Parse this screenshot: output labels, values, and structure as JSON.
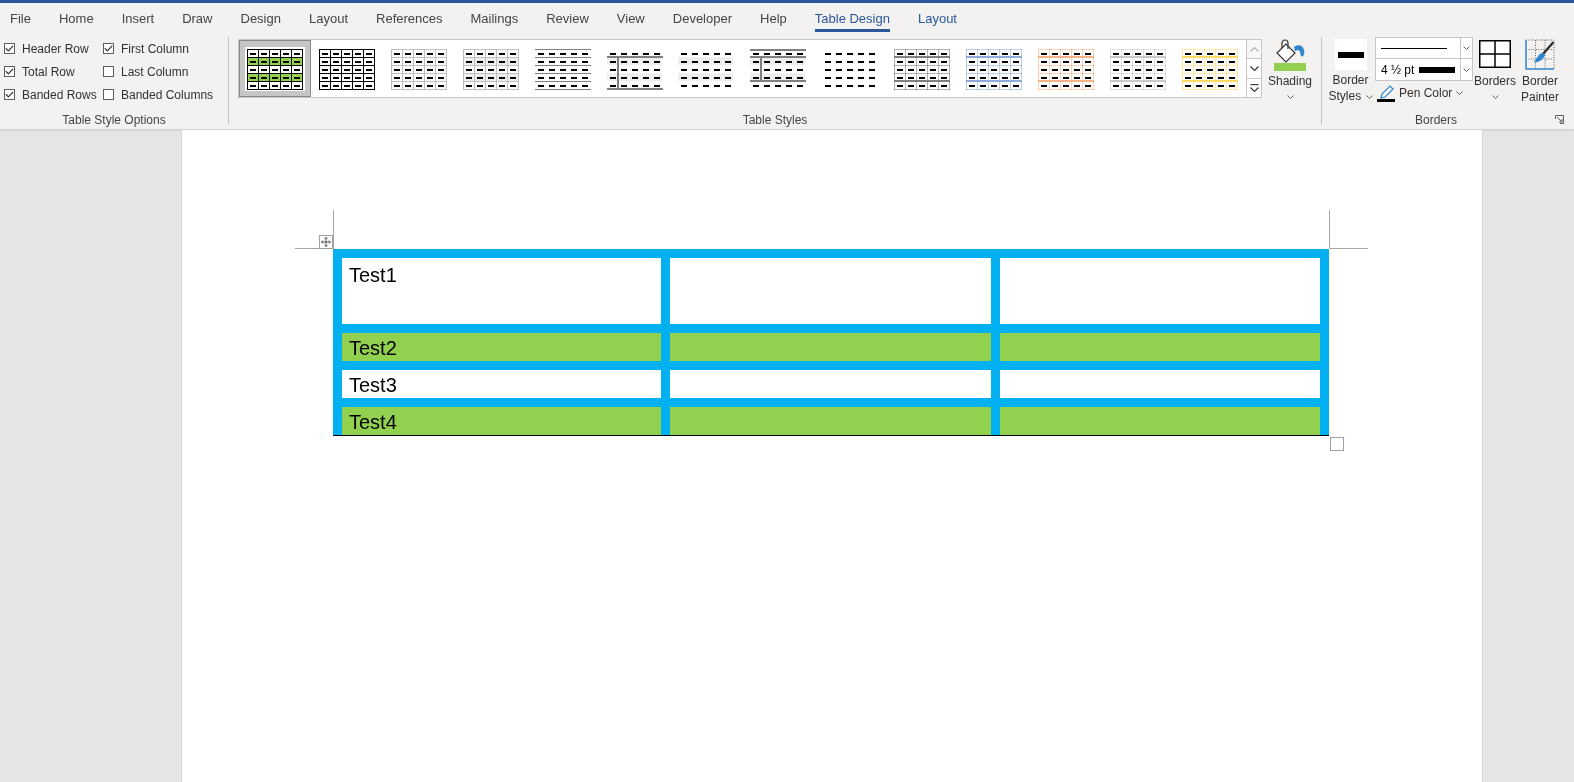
{
  "ribbon_tabs": [
    {
      "label": "File",
      "selected": false,
      "contextual": false
    },
    {
      "label": "Home",
      "selected": false,
      "contextual": false
    },
    {
      "label": "Insert",
      "selected": false,
      "contextual": false
    },
    {
      "label": "Draw",
      "selected": false,
      "contextual": false
    },
    {
      "label": "Design",
      "selected": false,
      "contextual": false
    },
    {
      "label": "Layout",
      "selected": false,
      "contextual": false
    },
    {
      "label": "References",
      "selected": false,
      "contextual": false
    },
    {
      "label": "Mailings",
      "selected": false,
      "contextual": false
    },
    {
      "label": "Review",
      "selected": false,
      "contextual": false
    },
    {
      "label": "View",
      "selected": false,
      "contextual": false
    },
    {
      "label": "Developer",
      "selected": false,
      "contextual": false
    },
    {
      "label": "Help",
      "selected": false,
      "contextual": false
    },
    {
      "label": "Table Design",
      "selected": true,
      "contextual": true
    },
    {
      "label": "Layout",
      "selected": false,
      "contextual": true
    }
  ],
  "table_style_options": {
    "options": [
      {
        "label": "Header Row",
        "checked": true
      },
      {
        "label": "First Column",
        "checked": true
      },
      {
        "label": "Total Row",
        "checked": true
      },
      {
        "label": "Last Column",
        "checked": false
      },
      {
        "label": "Banded Rows",
        "checked": true
      },
      {
        "label": "Banded Columns",
        "checked": false
      }
    ],
    "group_label": "Table Style Options"
  },
  "table_styles": {
    "gallery": [
      {
        "kind": "banded-grid",
        "color": "#92d050",
        "selected": true
      },
      {
        "kind": "grid",
        "color": "#000000",
        "selected": false
      },
      {
        "kind": "grid",
        "color": "#bfbfbf",
        "selected": false
      },
      {
        "kind": "shaded-grid",
        "color": "#bfbfbf",
        "selected": false
      },
      {
        "kind": "lines",
        "color": "#7f7f7f",
        "selected": false
      },
      {
        "kind": "header-column",
        "color": "#7f7f7f",
        "selected": false
      },
      {
        "kind": "bands",
        "selected": false
      },
      {
        "kind": "header-column-framed",
        "color": "#7f7f7f",
        "selected": false
      },
      {
        "kind": "plain",
        "selected": false
      },
      {
        "kind": "accent-grid",
        "color": "#7f7f7f",
        "selected": false
      },
      {
        "kind": "accent-grid",
        "color": "#8eaadb",
        "selected": false
      },
      {
        "kind": "accent-grid",
        "color": "#f4b183",
        "selected": false
      },
      {
        "kind": "accent-grid",
        "color": "#c9c9c9",
        "selected": false
      },
      {
        "kind": "accent-grid",
        "color": "#ffd966",
        "selected": false
      }
    ],
    "gallery_controls": [
      {
        "kind": "up",
        "disabled": true
      },
      {
        "kind": "down",
        "disabled": false
      },
      {
        "kind": "more",
        "disabled": false
      }
    ],
    "shading": {
      "label": "Shading"
    },
    "group_label": "Table Styles"
  },
  "borders": {
    "border_styles": {
      "label": "Border Styles"
    },
    "line_weight": {
      "value": "4 ½ pt"
    },
    "pen_color": {
      "label": "Pen Color"
    },
    "borders_button": {
      "label": "Borders"
    },
    "border_painter": {
      "label": "Border Painter"
    },
    "group_label": "Borders"
  },
  "document": {
    "table": {
      "rows": [
        {
          "column_1": "Test1",
          "color": "#ffffff"
        },
        {
          "column_1": "Test2",
          "color": "#92d050"
        },
        {
          "column_1": "Test3",
          "color": "#ffffff"
        },
        {
          "column_1": "Test4",
          "color": "#92d050"
        }
      ]
    }
  }
}
